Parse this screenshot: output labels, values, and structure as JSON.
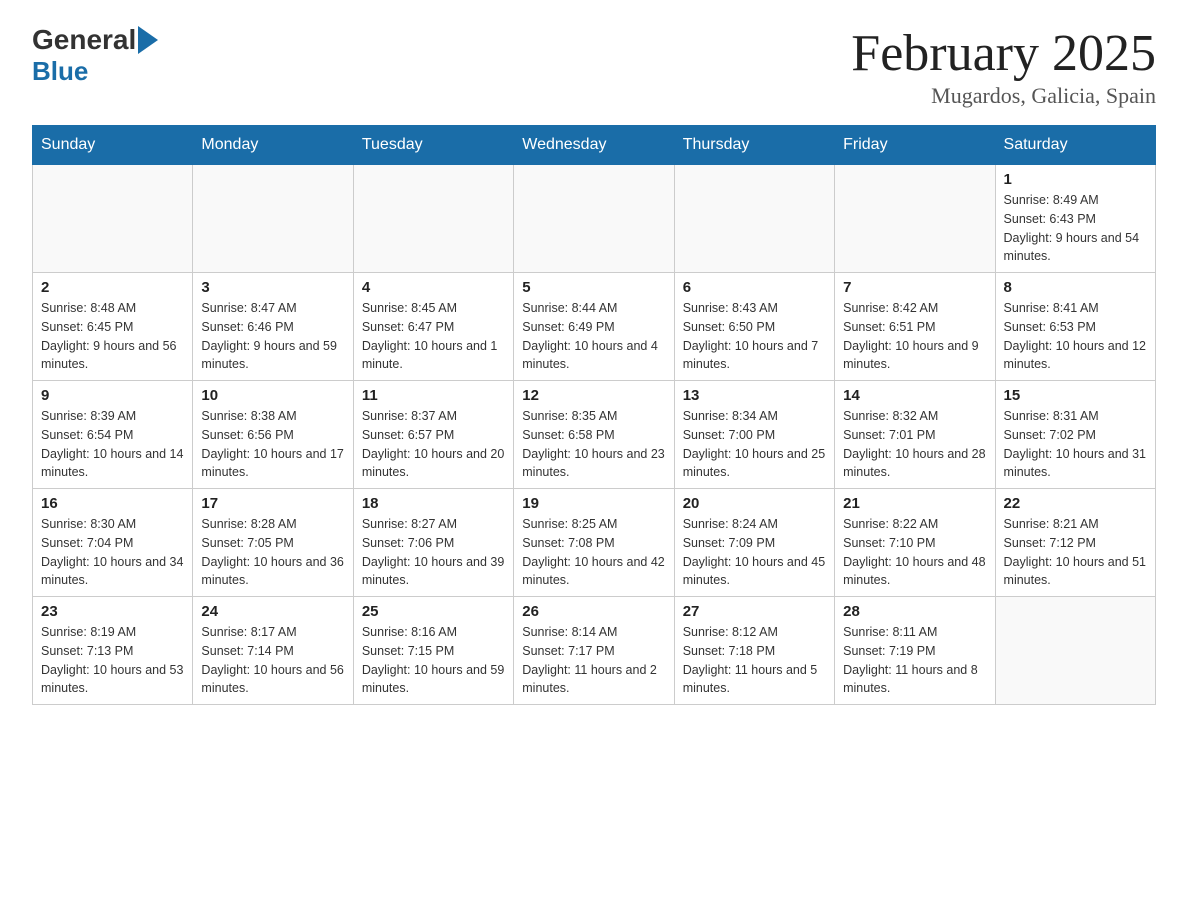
{
  "header": {
    "title": "February 2025",
    "subtitle": "Mugardos, Galicia, Spain",
    "logo_general": "General",
    "logo_blue": "Blue"
  },
  "days_of_week": [
    "Sunday",
    "Monday",
    "Tuesday",
    "Wednesday",
    "Thursday",
    "Friday",
    "Saturday"
  ],
  "weeks": [
    {
      "days": [
        {
          "num": "",
          "detail": ""
        },
        {
          "num": "",
          "detail": ""
        },
        {
          "num": "",
          "detail": ""
        },
        {
          "num": "",
          "detail": ""
        },
        {
          "num": "",
          "detail": ""
        },
        {
          "num": "",
          "detail": ""
        },
        {
          "num": "1",
          "detail": "Sunrise: 8:49 AM\nSunset: 6:43 PM\nDaylight: 9 hours and 54 minutes."
        }
      ]
    },
    {
      "days": [
        {
          "num": "2",
          "detail": "Sunrise: 8:48 AM\nSunset: 6:45 PM\nDaylight: 9 hours and 56 minutes."
        },
        {
          "num": "3",
          "detail": "Sunrise: 8:47 AM\nSunset: 6:46 PM\nDaylight: 9 hours and 59 minutes."
        },
        {
          "num": "4",
          "detail": "Sunrise: 8:45 AM\nSunset: 6:47 PM\nDaylight: 10 hours and 1 minute."
        },
        {
          "num": "5",
          "detail": "Sunrise: 8:44 AM\nSunset: 6:49 PM\nDaylight: 10 hours and 4 minutes."
        },
        {
          "num": "6",
          "detail": "Sunrise: 8:43 AM\nSunset: 6:50 PM\nDaylight: 10 hours and 7 minutes."
        },
        {
          "num": "7",
          "detail": "Sunrise: 8:42 AM\nSunset: 6:51 PM\nDaylight: 10 hours and 9 minutes."
        },
        {
          "num": "8",
          "detail": "Sunrise: 8:41 AM\nSunset: 6:53 PM\nDaylight: 10 hours and 12 minutes."
        }
      ]
    },
    {
      "days": [
        {
          "num": "9",
          "detail": "Sunrise: 8:39 AM\nSunset: 6:54 PM\nDaylight: 10 hours and 14 minutes."
        },
        {
          "num": "10",
          "detail": "Sunrise: 8:38 AM\nSunset: 6:56 PM\nDaylight: 10 hours and 17 minutes."
        },
        {
          "num": "11",
          "detail": "Sunrise: 8:37 AM\nSunset: 6:57 PM\nDaylight: 10 hours and 20 minutes."
        },
        {
          "num": "12",
          "detail": "Sunrise: 8:35 AM\nSunset: 6:58 PM\nDaylight: 10 hours and 23 minutes."
        },
        {
          "num": "13",
          "detail": "Sunrise: 8:34 AM\nSunset: 7:00 PM\nDaylight: 10 hours and 25 minutes."
        },
        {
          "num": "14",
          "detail": "Sunrise: 8:32 AM\nSunset: 7:01 PM\nDaylight: 10 hours and 28 minutes."
        },
        {
          "num": "15",
          "detail": "Sunrise: 8:31 AM\nSunset: 7:02 PM\nDaylight: 10 hours and 31 minutes."
        }
      ]
    },
    {
      "days": [
        {
          "num": "16",
          "detail": "Sunrise: 8:30 AM\nSunset: 7:04 PM\nDaylight: 10 hours and 34 minutes."
        },
        {
          "num": "17",
          "detail": "Sunrise: 8:28 AM\nSunset: 7:05 PM\nDaylight: 10 hours and 36 minutes."
        },
        {
          "num": "18",
          "detail": "Sunrise: 8:27 AM\nSunset: 7:06 PM\nDaylight: 10 hours and 39 minutes."
        },
        {
          "num": "19",
          "detail": "Sunrise: 8:25 AM\nSunset: 7:08 PM\nDaylight: 10 hours and 42 minutes."
        },
        {
          "num": "20",
          "detail": "Sunrise: 8:24 AM\nSunset: 7:09 PM\nDaylight: 10 hours and 45 minutes."
        },
        {
          "num": "21",
          "detail": "Sunrise: 8:22 AM\nSunset: 7:10 PM\nDaylight: 10 hours and 48 minutes."
        },
        {
          "num": "22",
          "detail": "Sunrise: 8:21 AM\nSunset: 7:12 PM\nDaylight: 10 hours and 51 minutes."
        }
      ]
    },
    {
      "days": [
        {
          "num": "23",
          "detail": "Sunrise: 8:19 AM\nSunset: 7:13 PM\nDaylight: 10 hours and 53 minutes."
        },
        {
          "num": "24",
          "detail": "Sunrise: 8:17 AM\nSunset: 7:14 PM\nDaylight: 10 hours and 56 minutes."
        },
        {
          "num": "25",
          "detail": "Sunrise: 8:16 AM\nSunset: 7:15 PM\nDaylight: 10 hours and 59 minutes."
        },
        {
          "num": "26",
          "detail": "Sunrise: 8:14 AM\nSunset: 7:17 PM\nDaylight: 11 hours and 2 minutes."
        },
        {
          "num": "27",
          "detail": "Sunrise: 8:12 AM\nSunset: 7:18 PM\nDaylight: 11 hours and 5 minutes."
        },
        {
          "num": "28",
          "detail": "Sunrise: 8:11 AM\nSunset: 7:19 PM\nDaylight: 11 hours and 8 minutes."
        },
        {
          "num": "",
          "detail": ""
        }
      ]
    }
  ]
}
